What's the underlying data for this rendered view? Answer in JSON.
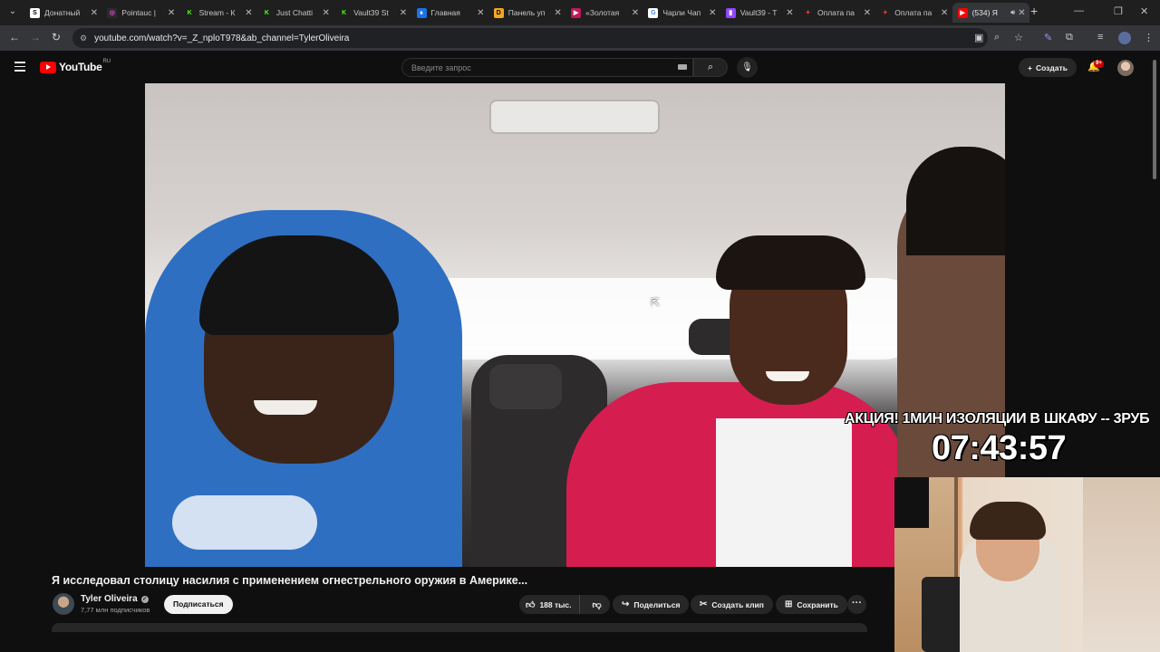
{
  "browser": {
    "tabs": [
      {
        "title": "Донатный",
        "fav": "S",
        "fav_color": "#ffffff",
        "fav_text": "#000000"
      },
      {
        "title": "Pointauc |",
        "fav": "◎",
        "fav_color": "#2b2b2b",
        "fav_text": "#e04bd1"
      },
      {
        "title": "Stream - К",
        "fav": "K",
        "fav_color": "#1f1f1f",
        "fav_text": "#53fc18"
      },
      {
        "title": "Just Chatti",
        "fav": "K",
        "fav_color": "#1f1f1f",
        "fav_text": "#53fc18"
      },
      {
        "title": "Vault39 St",
        "fav": "K",
        "fav_color": "#1f1f1f",
        "fav_text": "#53fc18"
      },
      {
        "title": "Главная",
        "fav": "⏸",
        "fav_color": "#1a73e8",
        "fav_text": "#ffffff"
      },
      {
        "title": "Панель уп",
        "fav": "D",
        "fav_color": "#f5a623",
        "fav_text": "#000000"
      },
      {
        "title": "«Золотая",
        "fav": "▶",
        "fav_color": "#c2185b",
        "fav_text": "#ffffff"
      },
      {
        "title": "Чарли Чап",
        "fav": "G",
        "fav_color": "#ffffff",
        "fav_text": "#4285f4"
      },
      {
        "title": "Vault39 - T",
        "fav": "▮",
        "fav_color": "#9146ff",
        "fav_text": "#ffffff"
      },
      {
        "title": "Оплата па",
        "fav": "✦",
        "fav_color": "#1f1f1f",
        "fav_text": "#e53935"
      },
      {
        "title": "Оплата па",
        "fav": "✦",
        "fav_color": "#1f1f1f",
        "fav_text": "#e53935"
      },
      {
        "title": "(534) Я",
        "fav": "▶",
        "fav_color": "#ff0000",
        "fav_text": "#ffffff",
        "active": true
      }
    ],
    "new_tab": "+",
    "url": "youtube.com/watch?v=_Z_nploT978&ab_channel=TylerOliveira"
  },
  "youtube": {
    "logo_text": "YouTube",
    "region": "RU",
    "search_placeholder": "Введите запрос",
    "create_label": "Создать",
    "notification_badge": "9+",
    "accent": "#ff0000"
  },
  "overlay": {
    "promo_text": "АКЦИЯ! 1МИН ИЗОЛЯЦИИ В ШКАФУ -- 3РУБ",
    "timer": "07:43:57"
  },
  "video": {
    "title": "Я исследовал столицу насилия с применением огнестрельного оружия в Америке...",
    "channel_name": "Tyler Oliveira",
    "subscribers": "7,77 млн подписчиков",
    "subscribe_label": "Подписаться",
    "likes": "188 тыс.",
    "share_label": "Поделиться",
    "clip_label": "Создать клип",
    "save_label": "Сохранить"
  }
}
